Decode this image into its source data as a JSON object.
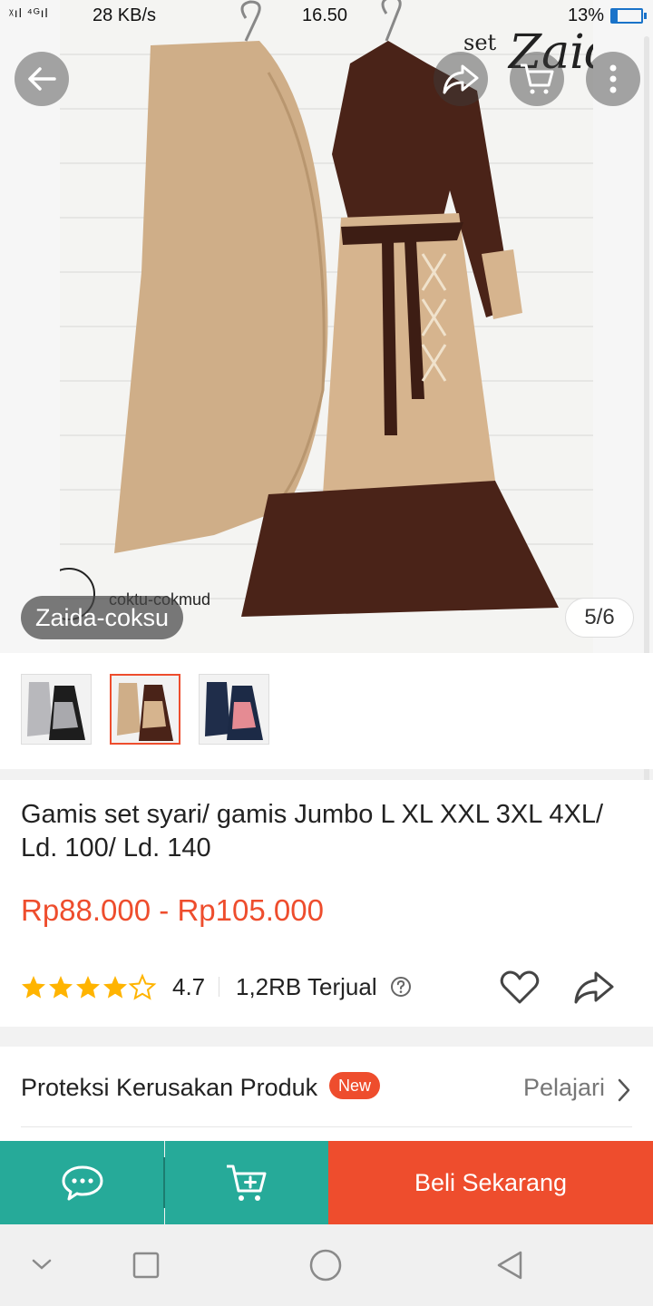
{
  "status_bar": {
    "signal": "ᵡıl ⁴ᴳıl",
    "speed": "28 KB/s",
    "time": "16.50",
    "battery": "13%"
  },
  "hero": {
    "variant_label": "Zaida-coksu",
    "counter": "5/6",
    "watermark_text": "coktu-cokmud",
    "brand_overlay": "set Zaida"
  },
  "thumbnails": [
    {
      "label": "grey-black",
      "selected": false
    },
    {
      "label": "coksu",
      "selected": true
    },
    {
      "label": "navy-pink",
      "selected": false
    }
  ],
  "product": {
    "title": "Gamis set syari/ gamis Jumbo L XL XXL 3XL 4XL/ Ld. 100/ Ld. 140",
    "price": "Rp88.000 - Rp105.000",
    "rating": "4.7",
    "rating_stars": 4.7,
    "sold": "1,2RB Terjual"
  },
  "protection": {
    "label": "Proteksi Kerusakan Produk",
    "badge": "New",
    "link": "Pelajari"
  },
  "actions": {
    "buy_now": "Beli Sekarang"
  },
  "colors": {
    "accent": "#ee4d2d",
    "teal": "#26aa99",
    "star": "#ffb400"
  },
  "icons": [
    "back-arrow-icon",
    "share-icon",
    "cart-icon",
    "more-icon",
    "star-icon",
    "help-icon",
    "heart-icon",
    "chat-icon",
    "add-to-cart-icon",
    "chevron-right-icon"
  ]
}
